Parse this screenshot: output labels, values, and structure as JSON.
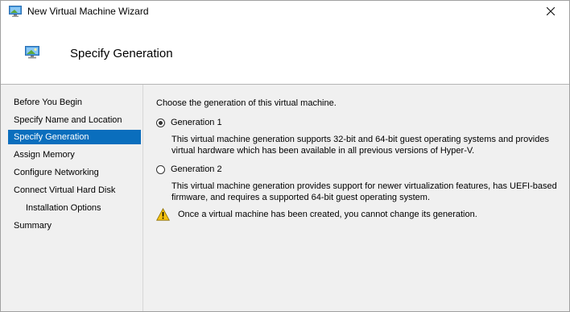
{
  "window": {
    "title": "New Virtual Machine Wizard",
    "app_icon": "virtual-machine-monitor-icon",
    "close_icon": "close-icon"
  },
  "header": {
    "title": "Specify Generation",
    "icon": "virtual-machine-monitor-icon"
  },
  "sidebar": {
    "items": [
      {
        "label": "Before You Begin",
        "selected": false
      },
      {
        "label": "Specify Name and Location",
        "selected": false
      },
      {
        "label": "Specify Generation",
        "selected": true
      },
      {
        "label": "Assign Memory",
        "selected": false
      },
      {
        "label": "Configure Networking",
        "selected": false
      },
      {
        "label": "Connect Virtual Hard Disk",
        "selected": false
      },
      {
        "label": "Installation Options",
        "selected": false
      },
      {
        "label": "Summary",
        "selected": false
      }
    ]
  },
  "main": {
    "prompt": "Choose the generation of this virtual machine.",
    "options": [
      {
        "label": "Generation 1",
        "checked": true,
        "description_line1": "This virtual machine generation supports 32-bit and 64-bit guest operating systems and provides",
        "description_line2": "virtual hardware which has been available in all previous versions of Hyper-V."
      },
      {
        "label": "Generation 2",
        "checked": false,
        "description_line1": "This virtual machine generation provides support for newer virtualization features, has UEFI-based",
        "description_line2": "firmware, and requires a supported 64-bit guest operating system."
      }
    ],
    "warning": {
      "icon": "warning-icon",
      "text": "Once a virtual machine has been created, you cannot change its generation."
    }
  },
  "colors": {
    "selection": "#0a6ebd",
    "panel_background": "#f0f0f0",
    "warning_yellow": "#f5c211"
  }
}
